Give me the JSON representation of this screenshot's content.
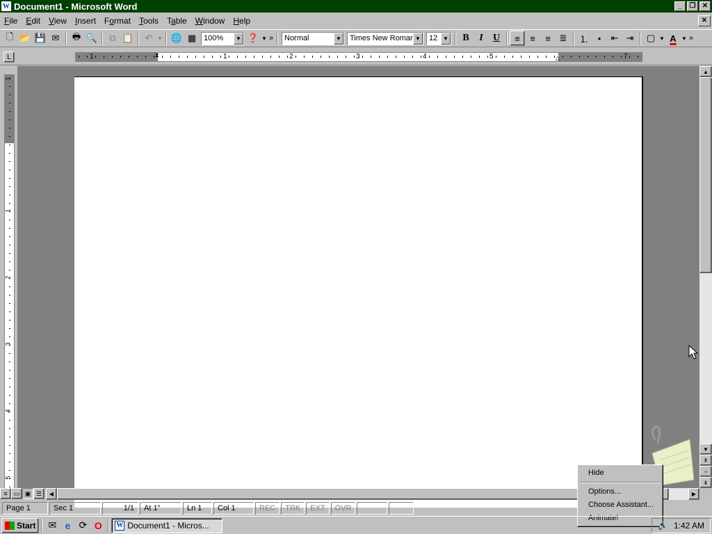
{
  "window": {
    "title": "Document1 - Microsoft Word",
    "app_icon": "W",
    "minimize": "_",
    "restore": "❐",
    "close": "✕"
  },
  "menubar": {
    "items": [
      {
        "label": "File",
        "accel": "F"
      },
      {
        "label": "Edit",
        "accel": "E"
      },
      {
        "label": "View",
        "accel": "V"
      },
      {
        "label": "Insert",
        "accel": "I"
      },
      {
        "label": "Format",
        "accel": "o"
      },
      {
        "label": "Tools",
        "accel": "T"
      },
      {
        "label": "Table",
        "accel": "a"
      },
      {
        "label": "Window",
        "accel": "W"
      },
      {
        "label": "Help",
        "accel": "H"
      }
    ],
    "doc_close": "✕"
  },
  "toolbar": {
    "zoom": "100%",
    "style": "Normal",
    "font": "Times New Roman",
    "size": "12",
    "bold": "B",
    "italic": "I",
    "underline": "U",
    "font_color": "#e00000",
    "more": "»"
  },
  "ruler": {
    "tab_selector": "L",
    "h_numbers": [
      "1",
      "1",
      "2",
      "3",
      "4",
      "5",
      "7"
    ],
    "v_numbers": [
      "1",
      "1",
      "2",
      "3",
      "4",
      "5"
    ]
  },
  "statusbar": {
    "page": "Page 1",
    "sec": "Sec 1",
    "pages": "1/1",
    "at": "At 1\"",
    "ln": "Ln 1",
    "col": "Col 1",
    "rec": "REC",
    "trk": "TRK",
    "ext": "EXT",
    "ovr": "OVR"
  },
  "context_menu": {
    "hide": "Hide",
    "options": "Options...",
    "choose": "Choose Assistant...",
    "animate": "Animate!"
  },
  "taskbar": {
    "start": "Start",
    "task_label": "Document1 - Micros...",
    "clock": "1:42 AM"
  },
  "colors": {
    "title_bg": "#004000",
    "face": "#c0c0c0",
    "workspace": "#808080"
  }
}
